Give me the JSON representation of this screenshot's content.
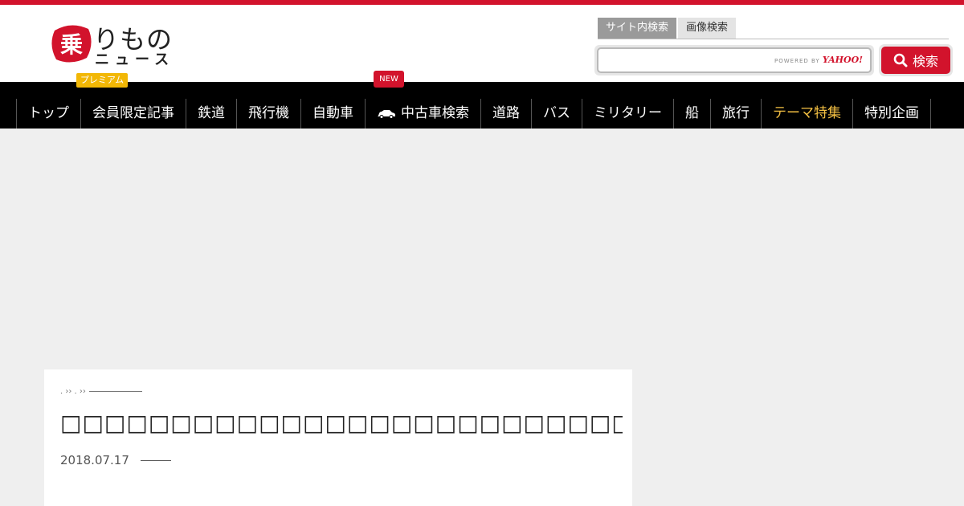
{
  "brand": {
    "logo_mark": "乗",
    "logo_text": "りもの",
    "logo_subtext": "ニュース",
    "premium_label": "プレミアム",
    "accent_color": "#d2132c"
  },
  "search": {
    "tabs": [
      "サイト内検索",
      "画像検索"
    ],
    "active_tab": 0,
    "input_value": "",
    "powered_by_prefix": "POWERED BY",
    "powered_by_brand": "YAHOO!",
    "button_label": "検索",
    "button_icon": "search-icon"
  },
  "nav": {
    "new_badge": "NEW",
    "items": [
      {
        "label": "トップ"
      },
      {
        "label": "会員限定記事"
      },
      {
        "label": "鉄道"
      },
      {
        "label": "飛行機"
      },
      {
        "label": "自動車"
      },
      {
        "label": "中古車検索",
        "icon": "car-icon"
      },
      {
        "label": "道路"
      },
      {
        "label": "バス"
      },
      {
        "label": "ミリタリー"
      },
      {
        "label": "船"
      },
      {
        "label": "旅行"
      },
      {
        "label": "テーマ特集",
        "highlight_color": "#f4c043"
      },
      {
        "label": "特別企画"
      }
    ]
  },
  "article": {
    "breadcrumb": ". ›› . ››",
    "title": "□□□□□□□□□□□□□□□□□□□□□□□□□□□□□□□□□□□□□□",
    "date": "2018.07.17"
  }
}
